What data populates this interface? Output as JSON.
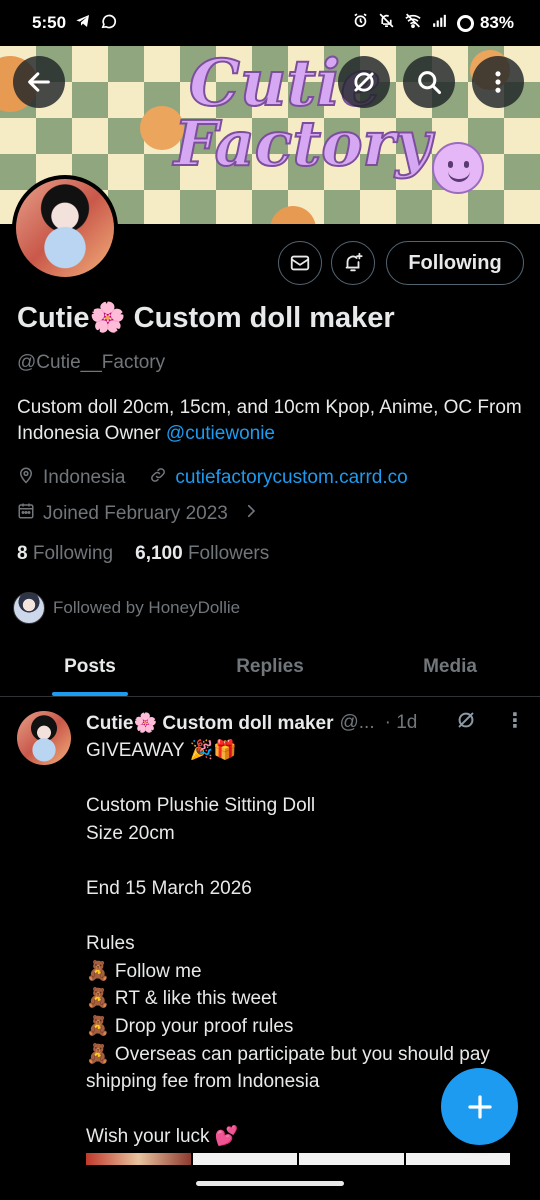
{
  "status_bar": {
    "time": "5:50",
    "left_icons": [
      "telegram-icon",
      "whatsapp-icon"
    ],
    "right_icons": [
      "alarm-icon",
      "mute-icon",
      "wifi-icon",
      "signal-icon"
    ],
    "battery": "83%"
  },
  "banner": {
    "title_line1": "Cutie",
    "title_line2": "Factory",
    "colors": {
      "check_green": "#8fa67e",
      "check_cream": "#f5ecc5",
      "title_purple": "#d6a8f4"
    }
  },
  "header_buttons": [
    "back-arrow-icon",
    "grok-icon",
    "search-icon",
    "more-vertical-icon"
  ],
  "profile": {
    "display_name": "Cutie🌸 Custom doll maker",
    "handle": "@Cutie__Factory",
    "bio_text": "Custom doll 20cm, 15cm, and 10cm Kpop, Anime, OC From Indonesia Owner ",
    "bio_mention": "@cutiewonie",
    "location": "Indonesia",
    "website": "cutiefactorycustom.carrd.co",
    "joined": "Joined February 2023",
    "following_count": "8",
    "following_label": "Following",
    "followers_count": "6,100",
    "followers_label": "Followers",
    "followed_by": "Followed by HoneyDollie"
  },
  "actions": {
    "following_button": "Following"
  },
  "tabs": [
    {
      "label": "Posts",
      "active": true
    },
    {
      "label": "Replies",
      "active": false
    },
    {
      "label": "Media",
      "active": false
    }
  ],
  "post": {
    "name": "Cutie🌸 Custom doll maker",
    "handle": "@...",
    "time": "· 1d",
    "more": "⋮",
    "body": "GIVEAWAY 🎉🎁\n\nCustom Plushie Sitting Doll\nSize 20cm\n\nEnd 15 March 2026\n\nRules\n🧸 Follow me\n🧸 RT & like this tweet\n🧸 Drop your proof rules\n🧸 Overseas can participate but you should pay shipping fee from Indonesia\n\nWish your luck 💕"
  },
  "fab": {
    "icon": "plus-icon"
  },
  "accent_color": "#1d9bf0"
}
